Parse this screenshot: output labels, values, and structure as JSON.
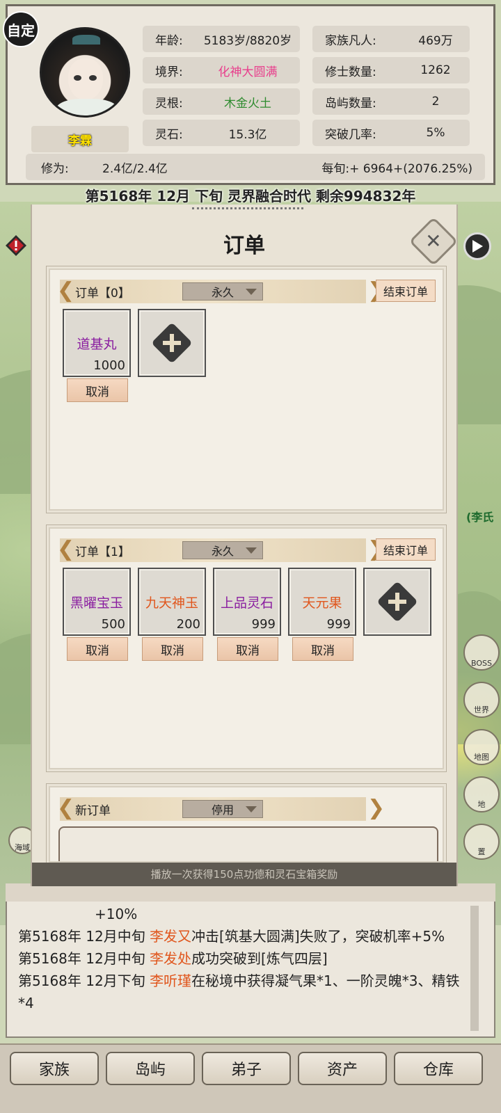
{
  "profile": {
    "badge": "自定",
    "name": "李霖"
  },
  "stats_left": [
    {
      "label": "年龄:",
      "value": "5183岁/8820岁",
      "color": "#222222"
    },
    {
      "label": "境界:",
      "value": "化神大圆满",
      "color": "#e83e8c"
    },
    {
      "label": "灵根:",
      "value": "木金火土",
      "color": "#2e8b2e"
    },
    {
      "label": "灵石:",
      "value": "15.3亿",
      "color": "#222222"
    }
  ],
  "stats_right": [
    {
      "label": "家族凡人:",
      "value": "469万"
    },
    {
      "label": "修士数量:",
      "value": "1262"
    },
    {
      "label": "岛屿数量:",
      "value": "2"
    },
    {
      "label": "突破几率:",
      "value": "5%"
    }
  ],
  "cultivation": {
    "label": "修为:",
    "value": "2.4亿/2.4亿",
    "per_period": "每旬:+ 6964+(2076.25%)"
  },
  "date_line": "第5168年 12月 下旬  灵界融合时代 剩余994832年",
  "side": {
    "tag": "(李氏",
    "icons": [
      "BOSS",
      "世界",
      "地图",
      "地",
      "置"
    ],
    "left_icon": "海域"
  },
  "modal": {
    "title": "订单",
    "close_label": "✕",
    "orders": [
      {
        "title": "订单【0】",
        "mode": "永久",
        "end_label": "结束订单",
        "items": [
          {
            "name": "道基丸",
            "count": "1000",
            "color": "purple"
          }
        ]
      },
      {
        "title": "订单【1】",
        "mode": "永久",
        "end_label": "结束订单",
        "items": [
          {
            "name": "黑曜宝玉",
            "count": "500",
            "color": "purple"
          },
          {
            "name": "九天神玉",
            "count": "200",
            "color": "orange"
          },
          {
            "name": "上品灵石",
            "count": "999",
            "color": "purple"
          },
          {
            "name": "天元果",
            "count": "999",
            "color": "orange"
          }
        ]
      }
    ],
    "new_order": {
      "title": "新订单",
      "mode": "停用"
    },
    "cancel_label": "取消",
    "bottom_text": "播放一次获得150点功德和灵石宝箱奖励"
  },
  "log": [
    {
      "prefix": "",
      "name": "",
      "text": "+10%"
    },
    {
      "prefix": "第5168年 12月中旬 ",
      "name": "李发又",
      "text": "冲击[筑基大圆满]失败了，突破机率+5%"
    },
    {
      "prefix": "第5168年 12月中旬 ",
      "name": "李发处",
      "text": "成功突破到[炼气四层]"
    },
    {
      "prefix": "第5168年 12月下旬 ",
      "name": "李听瑾",
      "text": "在秘境中获得凝气果*1、一阶灵魄*3、精铁*4"
    }
  ],
  "nav": [
    "家族",
    "岛屿",
    "弟子",
    "资产",
    "仓库"
  ]
}
